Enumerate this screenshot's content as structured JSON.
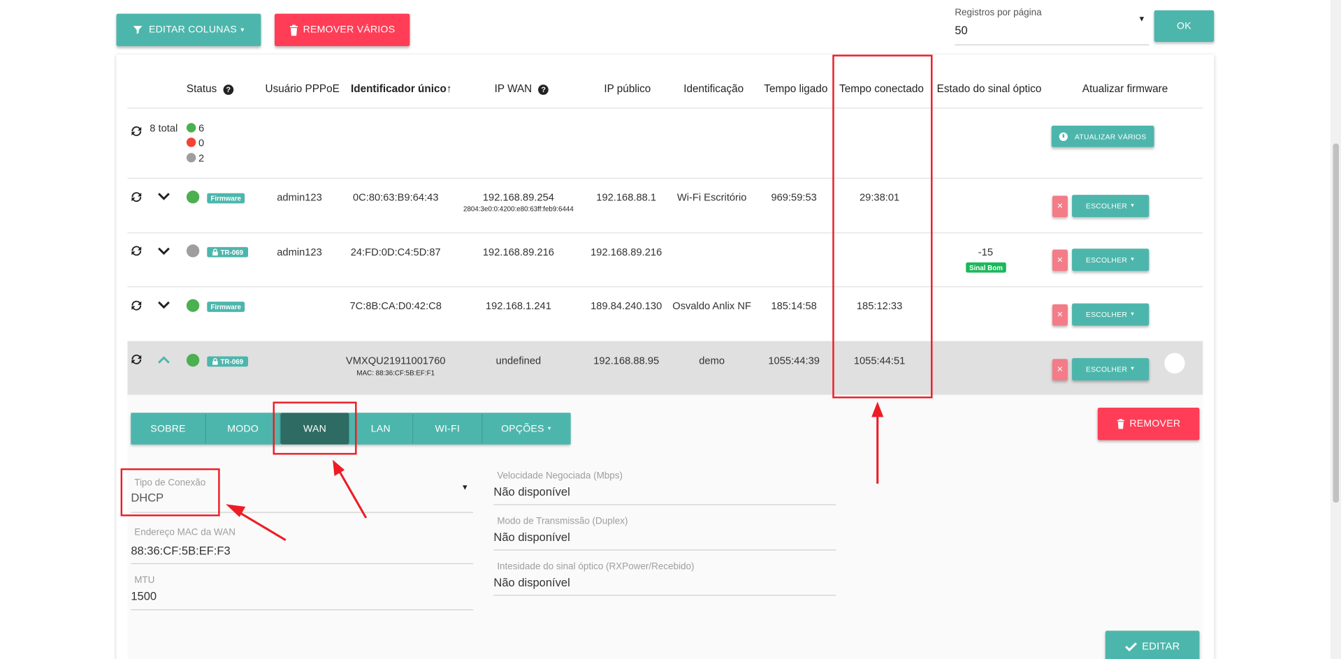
{
  "toolbar": {
    "edit_columns": "EDITAR COLUNAS",
    "remove_many": "REMOVER VÁRIOS",
    "per_page_label": "Registros por página",
    "per_page_value": "50",
    "ok": "OK"
  },
  "table": {
    "headers": [
      "Status",
      "Usuário PPPoE",
      "Identificador único↑",
      "IP WAN",
      "IP público",
      "Identificação",
      "Tempo ligado",
      "Tempo conectado",
      "Estado do sinal óptico",
      "Atualizar firmware"
    ],
    "summary": {
      "total": "8 total",
      "online": "6",
      "offline": "0",
      "unknown": "2",
      "update_many": "ATUALIZAR VÁRIOS"
    },
    "rows": [
      {
        "badge": "Firmware",
        "user": "admin123",
        "id": "0C:80:63:B9:64:43",
        "ip_wan": "192.168.89.254",
        "ip_wan_v6": "2804:3e0:0:4200:e80:63ff:feb9:6444",
        "ip_pub": "192.168.88.1",
        "ident": "Wi-Fi Escritório",
        "uptime": "969:59:53",
        "conn": "29:38:01",
        "signal": "",
        "signal_badge": "",
        "choose": "ESCOLHER"
      },
      {
        "badge": "TR-069",
        "user": "admin123",
        "id": "24:FD:0D:C4:5D:87",
        "ip_wan": "192.168.89.216",
        "ip_wan_v6": "",
        "ip_pub": "192.168.89.216",
        "ident": "",
        "uptime": "",
        "conn": "",
        "signal": "-15",
        "signal_badge": "Sinal Bom",
        "choose": "ESCOLHER"
      },
      {
        "badge": "Firmware",
        "user": "",
        "id": "7C:8B:CA:D0:42:C8",
        "ip_wan": "192.168.1.241",
        "ip_wan_v6": "",
        "ip_pub": "189.84.240.130",
        "ident": "Osvaldo Anlix NF",
        "uptime": "185:14:58",
        "conn": "185:12:33",
        "signal": "",
        "signal_badge": "",
        "choose": "ESCOLHER"
      },
      {
        "badge": "TR-069",
        "user": "",
        "id": "VMXQU21911001760",
        "id_mac": "MAC: 88:36:CF:5B:EF:F1",
        "ip_wan": "undefined",
        "ip_wan_v6": "",
        "ip_pub": "192.168.88.95",
        "ident": "demo",
        "uptime": "1055:44:39",
        "conn": "1055:44:51",
        "signal": "",
        "signal_badge": "",
        "choose": "ESCOLHER"
      }
    ]
  },
  "detail": {
    "tabs": [
      "SOBRE",
      "MODO",
      "WAN",
      "LAN",
      "WI-FI",
      "OPÇÕES"
    ],
    "remove": "REMOVER",
    "edit": "EDITAR",
    "fields_left": [
      {
        "label": "Tipo de Conexão",
        "value": "DHCP"
      },
      {
        "label": "Endereço MAC da WAN",
        "value": "88:36:CF:5B:EF:F3"
      },
      {
        "label": "MTU",
        "value": "1500"
      }
    ],
    "fields_right": [
      {
        "label": "Velocidade Negociada (Mbps)",
        "value": "Não disponível"
      },
      {
        "label": "Modo de Transmissão (Duplex)",
        "value": "Não disponível"
      },
      {
        "label": "Intesidade do sinal óptico (RXPower/Recebido)",
        "value": "Não disponível"
      }
    ]
  },
  "colors": {
    "teal": "#4db6ac",
    "red": "#ff3d57",
    "dark_teal": "#2e6b63",
    "annotation": "#ee1c25",
    "online": "#4caf50",
    "offline": "#f44336",
    "unknown": "#9e9e9e"
  }
}
